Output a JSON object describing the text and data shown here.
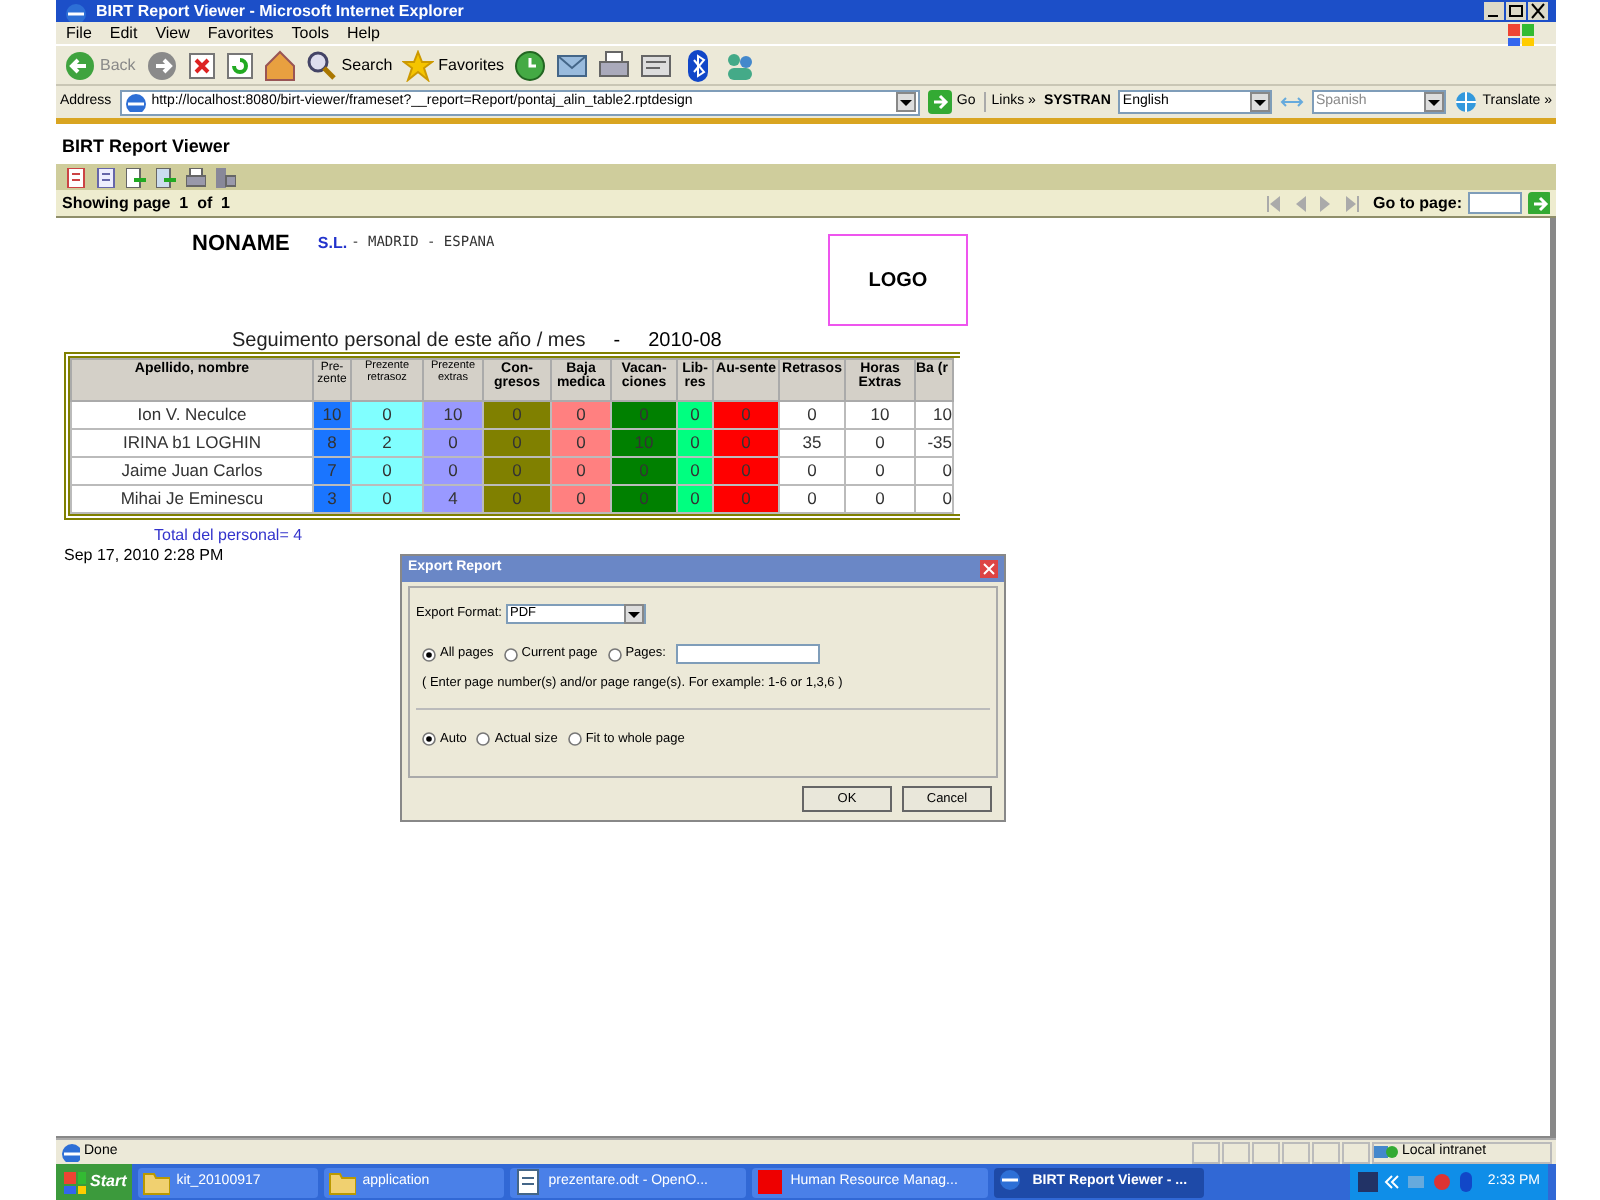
{
  "window": {
    "title": "BIRT Report Viewer - Microsoft Internet Explorer"
  },
  "menu": [
    "File",
    "Edit",
    "View",
    "Favorites",
    "Tools",
    "Help"
  ],
  "toolbar": {
    "back": "Back",
    "search": "Search",
    "favorites": "Favorites"
  },
  "address_bar": {
    "label": "Address",
    "url": "http://localhost:8080/birt-viewer/frameset?__report=Report/pontaj_alin_table2.rptdesign",
    "go": "Go",
    "links": "Links",
    "links_more": "»",
    "systran": "SYSTRAN",
    "from_language": "English",
    "to_language": "Spanish",
    "translate": "Translate",
    "translate_more": "»"
  },
  "viewer": {
    "title": "BIRT Report Viewer",
    "page_info": "Showing page  1  of  1",
    "goto_label": "Go to page:"
  },
  "report": {
    "company": "NONAME",
    "company_suffix": "S.L.",
    "location": "- MADRID - ESPANA",
    "logo": "LOGO",
    "title": "Seguimento personal de este año / mes",
    "title_separator": "-",
    "period": "2010-08",
    "total": "Total del personal= 4",
    "date": "Sep 17, 2010 2:28 PM"
  },
  "table": {
    "columns": [
      {
        "label": "Apellido, nombre"
      },
      {
        "label": "Pre-zente",
        "color": "#1a75ff"
      },
      {
        "label": "Prezente retrasoz",
        "color": "#80ffff"
      },
      {
        "label": "Prezente extras",
        "color": "#9999ff"
      },
      {
        "label": "Con-gresos",
        "color": "#808000"
      },
      {
        "label": "Baja medica",
        "color": "#ff8080"
      },
      {
        "label": "Vacan-ciones",
        "color": "#008000"
      },
      {
        "label": "Lib-res",
        "color": "#00ff80"
      },
      {
        "label": "Au-sente",
        "color": "#ff0000"
      },
      {
        "label": "Retrasos"
      },
      {
        "label": "Horas Extras"
      },
      {
        "label": "Ba (r"
      }
    ],
    "rows": [
      [
        "Ion  V.  Neculce",
        "10",
        "0",
        "10",
        "0",
        "0",
        "0",
        "0",
        "0",
        "0",
        "10",
        "10"
      ],
      [
        "IRINA  b1  LOGHIN",
        "8",
        "2",
        "0",
        "0",
        "0",
        "10",
        "0",
        "0",
        "35",
        "0",
        "-35"
      ],
      [
        "Jaime  Juan  Carlos",
        "7",
        "0",
        "0",
        "0",
        "0",
        "0",
        "0",
        "0",
        "0",
        "0",
        "0"
      ],
      [
        "Mihai  Je  Eminescu",
        "3",
        "0",
        "4",
        "0",
        "0",
        "0",
        "0",
        "0",
        "0",
        "0",
        "0"
      ]
    ]
  },
  "dialog": {
    "title": "Export Report",
    "format_label": "Export Format:",
    "format": "PDF",
    "page_options": [
      {
        "label": "All pages",
        "selected": true
      },
      {
        "label": "Current page",
        "selected": false
      },
      {
        "label": "Pages:",
        "selected": false
      }
    ],
    "hint": "( Enter page number(s) and/or page range(s). For example: 1-6 or 1,3,6 )",
    "size_options": [
      {
        "label": "Auto",
        "selected": true
      },
      {
        "label": "Actual size",
        "selected": false
      },
      {
        "label": "Fit to whole page",
        "selected": false
      }
    ],
    "buttons": [
      "OK",
      "Cancel"
    ]
  },
  "status_bar": {
    "text": "Done",
    "zone": "Local intranet"
  },
  "taskbar": {
    "start": "Start",
    "items": [
      {
        "label": "kit_20100917",
        "kind": "folder",
        "selected": false
      },
      {
        "label": "application",
        "kind": "folder",
        "selected": false
      },
      {
        "label": "prezentare.odt - OpenO...",
        "kind": "document",
        "selected": false
      },
      {
        "label": "Human Resource Manag...",
        "kind": "app",
        "selected": false
      },
      {
        "label": "BIRT Report Viewer - ...",
        "kind": "browser",
        "selected": true
      }
    ],
    "clock": "2:33 PM"
  }
}
